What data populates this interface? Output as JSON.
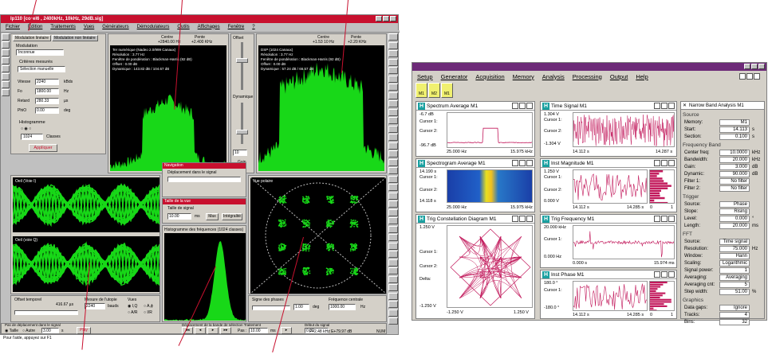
{
  "left_app": {
    "title": "Ip110  [corel6 , 2400kHz, 10kHz, 29dB.sig]",
    "menu": [
      "Fichier",
      "Édition",
      "Traitements",
      "Vues",
      "Générateurs",
      "Démodulateurs",
      "Outils",
      "Affichages",
      "Fenêtre",
      "?"
    ],
    "tabs": [
      "Modulation linéaire",
      "Modulation non linéaire"
    ],
    "modulation_label": "Modulation",
    "modulation_value": "Inconnue",
    "critere_label": "Critères mesurés",
    "critere_value": "Sélection manuelle",
    "params": [
      {
        "k": "Vitesse",
        "v": "2240",
        "u": "kBds"
      },
      {
        "k": "Fo",
        "v": "1800.00",
        "u": "Hz"
      },
      {
        "k": "Retard",
        "v": "280.33",
        "u": "µs"
      },
      {
        "k": "PhiO",
        "v": "0.00",
        "u": "deg"
      }
    ],
    "histogram_label": "Histogramme",
    "histogram_value": "1024",
    "histogram_unit": "Classes",
    "apply_label": "Appliquer",
    "top_plot": {
      "center_label": "Centre",
      "center_value": "+2840.00 Hz",
      "pente_label": "Pente",
      "pente_value": "+2.400 KHz",
      "info": [
        "Ter numérique (Nadeo 2.0/999 Canaux)",
        "Résolution : 3.77 Hz",
        "Fenêtre de pondération : Blackman-Harris (92 dB)",
        "Offset : 0.00 dB",
        "Dynamique : 143.82 dB / 104.67 dB"
      ]
    },
    "offset_label": "Offset",
    "dynamique_label": "Dynamique",
    "dyn_value": "10",
    "gain_label": "Gain",
    "right_plot": {
      "center_label": "Centre",
      "center_value": "+1.53 10 Hz",
      "pente_label": "Pente",
      "pente_value": "+2.20 KHz",
      "info": [
        "DSP (1024 Canaux)",
        "Résolution : 3.77 Hz",
        "Fenêtre de pondération : Blackman-Harris (92 dB)",
        "Offset : 0.00 dB",
        "Dynamique : 57.24 dB / 66.57 dB"
      ]
    },
    "eye1_label": "Oeil (Voie I)",
    "eye2_label": "Oeil (voie Q)",
    "nav_title": "Navigation",
    "nav_sub": "Déplacement dans le signal",
    "taille_title": "Taille de la vue",
    "taille_sub": "Taille de signal",
    "taille_value": "10.00",
    "taille_unit": "ms",
    "max_label": "Max",
    "integralite_label": "Intégralité",
    "hist_title": "Histogramme des fréquences (1024 classes)",
    "vue_polaire_label": "Vue polaire",
    "offset_temporel_label": "Offset temporel",
    "offset_temporel_value": "416.67 µs",
    "mesure_label": "Mesure de l'utopie",
    "mesure_value": "2240",
    "mesure_unit": "bauds",
    "vues_label": "Vues",
    "vues_opts": [
      "I,Q",
      "A,ϕ",
      "A/R",
      "I/R"
    ],
    "signe_label": "Signe des phases",
    "signe_value": "1.00",
    "signe_unit": "deg",
    "freq_centrale_label": "Fréquence centrale",
    "freq_centrale_value": "1000.00",
    "freq_centrale_unit": "Hz",
    "pas_label": "Pas de déplacement dans le signal",
    "taille_radio": "Taille",
    "autre_radio": "Autre",
    "pas_value": "3.00",
    "pas_unit": "s",
    "play_label": "Play",
    "deplacement_label": "Déplacement de la bande de sélection Traitement",
    "pas2_label": "Pas :",
    "pas2_value": "10.00",
    "pas2_unit": "ms",
    "debut_label": "Début du signal",
    "debut_value": "0.00",
    "status_left": "Pour l'aide, appuyez sur F1",
    "status_mid": "F+2.48 kHz  E+79.97 dB",
    "status_right": "NUM"
  },
  "right_app": {
    "menu": [
      "Setup",
      "Generator",
      "Acquisition",
      "Memory",
      "Analysis",
      "Processing",
      "Output",
      "Help"
    ],
    "mem_buttons": [
      "M1",
      "M2",
      "M1"
    ],
    "spectrum": {
      "title": "Spectrum Average M1",
      "top": "-6.7 dB",
      "cursor1": "Cursor 1:",
      "cursor2": "Cursor 2:",
      "bottom": "-96.7 dB",
      "xstart": "25.000 Hz",
      "xend": "15.975 kHz"
    },
    "spectrogram": {
      "title": "Spectrogram Average M1",
      "top": "14.190 s",
      "cursor1": "Cursor 1:",
      "cursor2": "Cursor 2:",
      "bottom": "14.118 s",
      "xstart": "25.000 Hz",
      "xend": "15.975 kHz"
    },
    "constellation": {
      "title": "Trig Constellation Diagram M1",
      "top": "1.250 V",
      "cursor1": "Cursor 1:",
      "cursor2": "Cursor 2:",
      "delta": "Delta:",
      "bottom": "-1.250 V",
      "xstart": "-1.250 V",
      "xend": "1.250 V"
    },
    "time_signal": {
      "title": "Time Signal M1",
      "top": "1.304 V",
      "cursor1": "Cursor 1:",
      "cursor2": "Cursor 2:",
      "bottom": "-1.304 V",
      "xstart": "14.112 s",
      "xend": "14.287 s"
    },
    "inst_mag": {
      "title": "Inst Magnitude M1",
      "top": "1.250 V",
      "cursor1": "Cursor 1:",
      "cursor2": "Cursor 2:",
      "bottom": "0.000 V",
      "xstart": "14.112 s",
      "xend": "14.285 s",
      "hx0": "0",
      "hx1": "1"
    },
    "trig_freq": {
      "title": "Trig Frequency M1",
      "top": "20.000 kHz",
      "cursor1": "Cursor 1:",
      "bottom": "0.000 Hz",
      "xstart": "0.000 s",
      "xend": "15.974 ms"
    },
    "inst_phase": {
      "title": "Inst Phase M1",
      "top": "180.0 °",
      "cursor1": "Cursor 1:",
      "bottom": "-180.0 °",
      "xstart": "14.112 s",
      "xend": "14.285 s",
      "hx0": "0",
      "hx1": "1"
    },
    "nba": {
      "title": "Narrow Band Analysis M1",
      "source_section": "Source",
      "source": [
        {
          "k": "Memory:",
          "v": "M1",
          "u": ""
        },
        {
          "k": "Start:",
          "v": "14.113",
          "u": "s"
        },
        {
          "k": "Section:",
          "v": "0.100",
          "u": "s"
        }
      ],
      "freq_section": "Frequency Band",
      "freq": [
        {
          "k": "Center freq:",
          "v": "10.0000",
          "u": "kHz"
        },
        {
          "k": "Bandwidth:",
          "v": "20.000",
          "u": "kHz"
        },
        {
          "k": "Gain:",
          "v": "3.000",
          "u": "dB"
        },
        {
          "k": "Dynamic:",
          "v": "90.000",
          "u": "dB"
        },
        {
          "k": "Filter 1:",
          "v": "No filter",
          "u": ""
        },
        {
          "k": "Filter 2:",
          "v": "No filter",
          "u": ""
        }
      ],
      "trigger_section": "Trigger",
      "trigger": [
        {
          "k": "Source:",
          "v": "Phase",
          "u": ""
        },
        {
          "k": "Slope:",
          "v": "Rising",
          "u": ""
        },
        {
          "k": "Level:",
          "v": "0.000",
          "u": "°"
        },
        {
          "k": "Length:",
          "v": "20.000",
          "u": "ms"
        }
      ],
      "fft_section": "FFT",
      "fft": [
        {
          "k": "Source:",
          "v": "Time signal",
          "u": ""
        },
        {
          "k": "Resolution:",
          "v": "75.000",
          "u": "Hz"
        },
        {
          "k": "Window:",
          "v": "Hann",
          "u": ""
        },
        {
          "k": "Scaling:",
          "v": "Logarithmic",
          "u": ""
        },
        {
          "k": "Signal power:",
          "v": "1",
          "u": ""
        },
        {
          "k": "Averaging:",
          "v": "Averaging",
          "u": ""
        },
        {
          "k": "Averaging cnt:",
          "v": "5",
          "u": ""
        },
        {
          "k": "Step width:",
          "v": "51.00",
          "u": "%"
        }
      ],
      "graphics_section": "Graphics",
      "graphics": [
        {
          "k": "Data gaps:",
          "v": "Ignore",
          "u": ""
        },
        {
          "k": "Tracks:",
          "v": "4",
          "u": ""
        },
        {
          "k": "Bins:",
          "v": "32",
          "u": ""
        }
      ]
    }
  },
  "colors": {
    "trace_green": "#18d818",
    "trace_red": "#c2185b",
    "title_red": "#c8102e",
    "title_purple": "#6d2a78",
    "teal": "#1aa0a0"
  }
}
